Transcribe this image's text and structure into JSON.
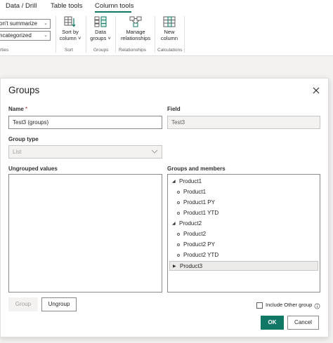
{
  "ribbon": {
    "tabs": [
      {
        "label": "Data / Drill"
      },
      {
        "label": "Table tools"
      },
      {
        "label": "Column tools"
      }
    ],
    "summarize_value": "on't summarize",
    "category_value": "ncategorized",
    "properties_label": "rties",
    "sort_by_column": "Sort by\ncolumn",
    "sort_by_column_l1": "Sort by",
    "sort_by_column_l2": "column",
    "sort_label": "Sort",
    "data_groups_l1": "Data",
    "data_groups_l2": "groups",
    "groups_label": "Groups",
    "manage_rel_l1": "Manage",
    "manage_rel_l2": "relationships",
    "relationships_label": "Relationships",
    "new_column_l1": "New",
    "new_column_l2": "column",
    "calculations_label": "Calculations",
    "accent_color": "#117865"
  },
  "dialog": {
    "title": "Groups",
    "name_label": "Name",
    "name_required": "*",
    "name_value": "Test3 (groups)",
    "field_label": "Field",
    "field_value": "Test3",
    "group_type_label": "Group type",
    "group_type_value": "List",
    "ungrouped_label": "Ungrouped values",
    "groups_members_label": "Groups and members",
    "tree": [
      {
        "label": "Product1",
        "level": 0,
        "expanded": true
      },
      {
        "label": "Product1",
        "level": 1
      },
      {
        "label": "Product1 PY",
        "level": 1
      },
      {
        "label": "Product1 YTD",
        "level": 1
      },
      {
        "label": "Product2",
        "level": 0,
        "expanded": true
      },
      {
        "label": "Product2",
        "level": 1
      },
      {
        "label": "Product2 PY",
        "level": 1
      },
      {
        "label": "Product2 YTD",
        "level": 1
      },
      {
        "label": "Product3",
        "level": 0,
        "expanded": false,
        "selected": true
      }
    ],
    "group_button": "Group",
    "ungroup_button": "Ungroup",
    "include_other_label": "Include Other group",
    "include_other_checked": false,
    "ok_button": "OK",
    "cancel_button": "Cancel"
  }
}
